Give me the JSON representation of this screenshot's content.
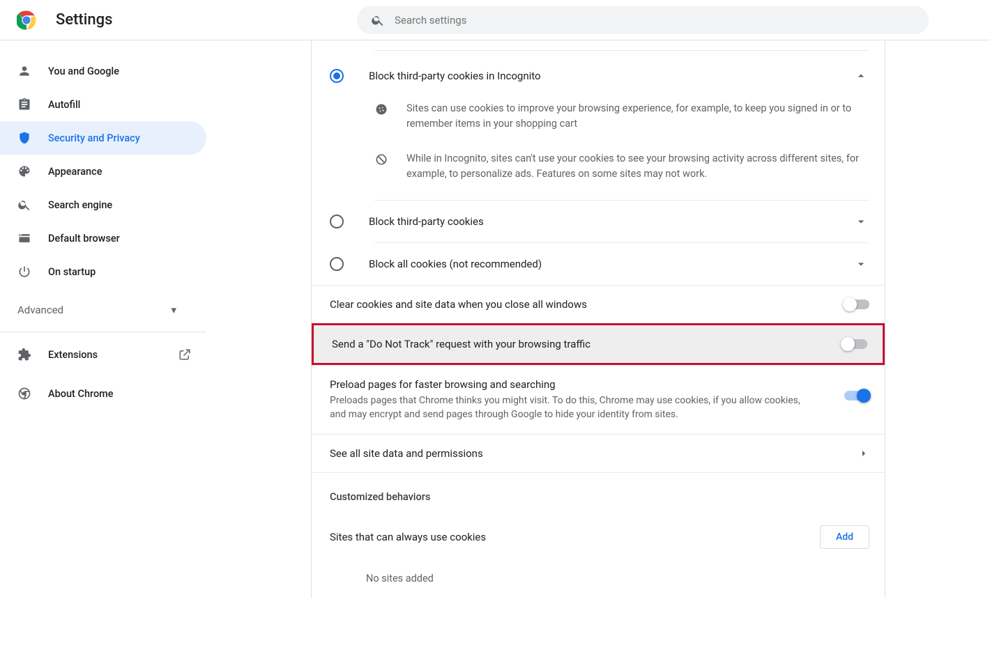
{
  "header": {
    "brand": "Settings",
    "search_placeholder": "Search settings"
  },
  "sidebar": {
    "items": [
      {
        "label": "You and Google"
      },
      {
        "label": "Autofill"
      },
      {
        "label": "Security and Privacy"
      },
      {
        "label": "Appearance"
      },
      {
        "label": "Search engine"
      },
      {
        "label": "Default browser"
      },
      {
        "label": "On startup"
      }
    ],
    "advanced": "Advanced",
    "extensions": "Extensions",
    "about": "About Chrome"
  },
  "cookies": {
    "opt_selected": "Block third-party cookies in Incognito",
    "desc1": "Sites can use cookies to improve your browsing experience, for example, to keep you signed in or to remember items in your shopping cart",
    "desc2": "While in Incognito, sites can't use your cookies to see your browsing activity across different sites, for example, to personalize ads. Features on some sites may not work.",
    "opt_block_third": "Block third-party cookies",
    "opt_block_all": "Block all cookies (not recommended)"
  },
  "settings": {
    "clear_on_close": "Clear cookies and site data when you close all windows",
    "dnt": "Send a \"Do Not Track\" request with your browsing traffic",
    "preload_title": "Preload pages for faster browsing and searching",
    "preload_desc": "Preloads pages that Chrome thinks you might visit. To do this, Chrome may use cookies, if you allow cookies, and may encrypt and send pages through Google to hide your identity from sites.",
    "see_all": "See all site data and permissions"
  },
  "section": {
    "custom": "Customized behaviors",
    "sites_label": "Sites that can always use cookies",
    "add": "Add",
    "none": "No sites added"
  }
}
